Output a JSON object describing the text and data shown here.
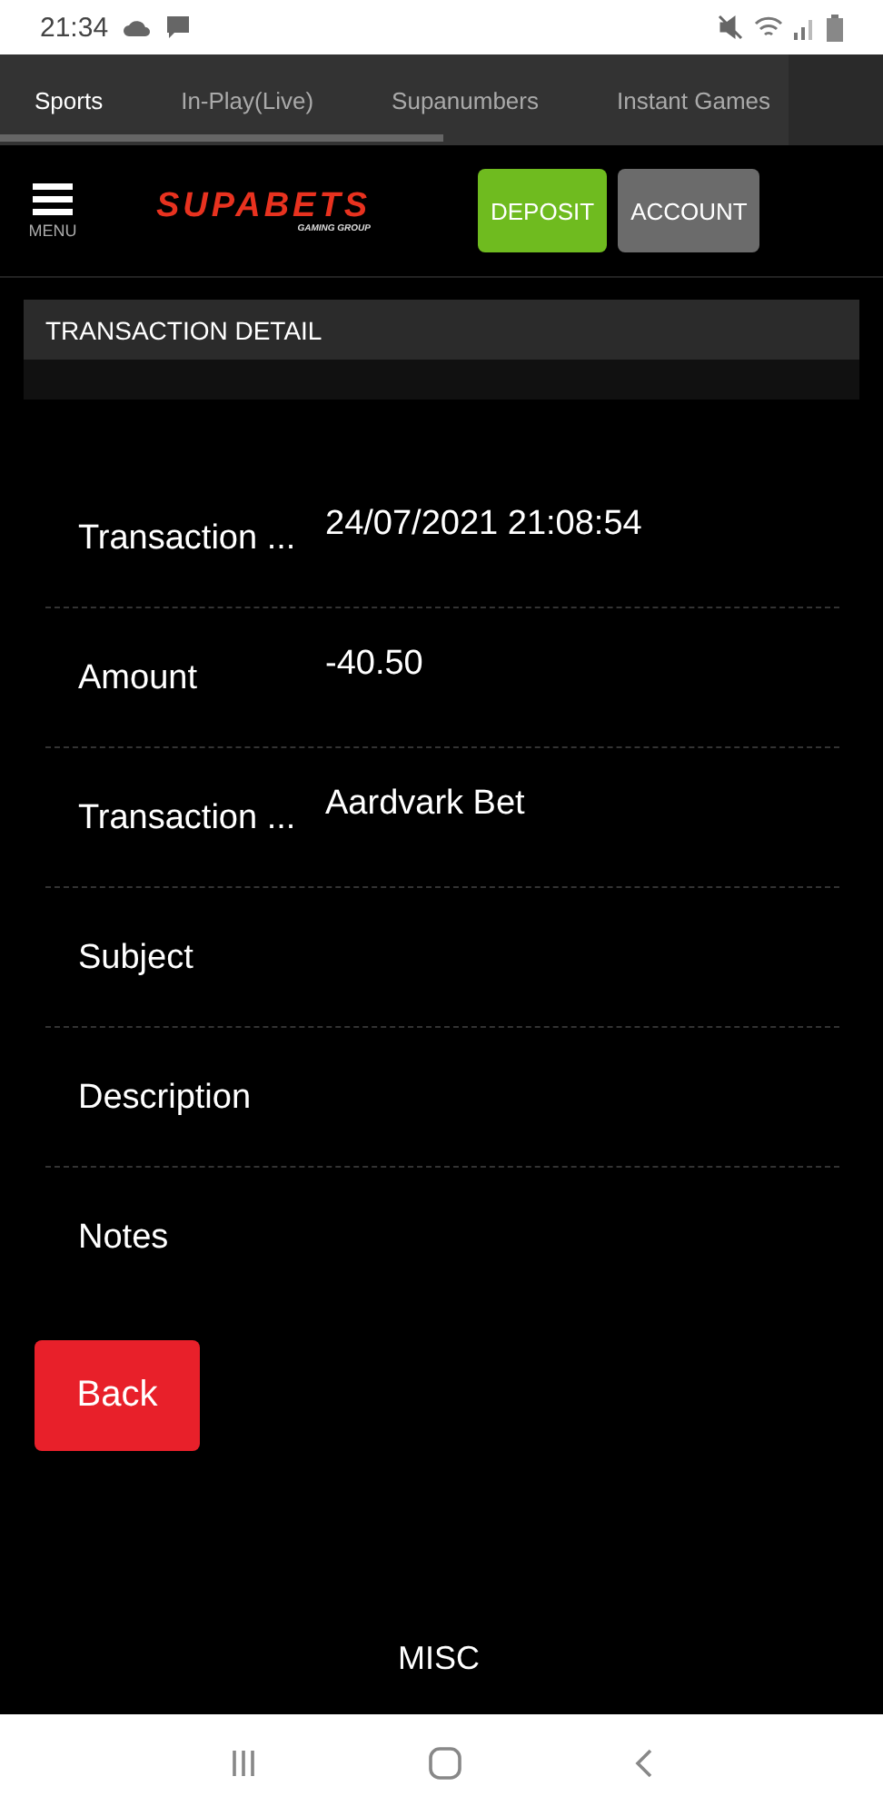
{
  "status_bar": {
    "time": "21:34"
  },
  "tabs": [
    {
      "label": "Sports",
      "selected": true
    },
    {
      "label": "In-Play(Live)",
      "selected": false
    },
    {
      "label": "Supanumbers",
      "selected": false
    },
    {
      "label": "Instant Games",
      "selected": false
    }
  ],
  "header": {
    "menu_label": "MENU",
    "logo": {
      "name": "SUPABETS",
      "tagline": "GAMING GROUP"
    },
    "buttons": [
      {
        "label": "DEPOSIT",
        "kind": "primary"
      },
      {
        "label": "ACCOUNT",
        "kind": "secondary"
      }
    ]
  },
  "section": {
    "title": "TRANSACTION DETAIL"
  },
  "details": [
    {
      "label": "Transaction ...",
      "value": "24/07/2021 21:08:54"
    },
    {
      "label": "Amount",
      "value": "-40.50"
    },
    {
      "label": "Transaction ...",
      "value": "Aardvark Bet"
    },
    {
      "label": "Subject"
    },
    {
      "label": "Description"
    },
    {
      "label": "Notes"
    }
  ],
  "back_button": "Back",
  "footer": {
    "heading": "MISC"
  }
}
